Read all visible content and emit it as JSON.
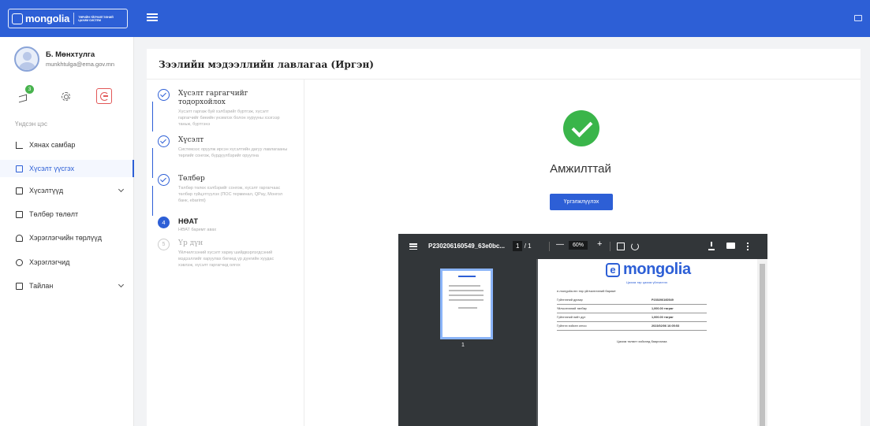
{
  "header": {
    "brand": "mongolia",
    "brand_subtitle": "ТӨРИЙН ҮЙЛЧИЛГЭЭНИЙ ЦАХИМ СИСТЕМ",
    "brand_color": "#2d5fd6"
  },
  "user": {
    "name": "Б. Мөнхтулга",
    "email": "munkhtulga@ema.gov.mn",
    "notification_count": "3"
  },
  "sidebar": {
    "section_label": "Үндсэн цэс",
    "items": [
      {
        "label": "Хянах самбар",
        "icon": "chart-icon"
      },
      {
        "label": "Хүсэлт үүсгэх",
        "icon": "document-icon",
        "active": true
      },
      {
        "label": "Хүсэлтүүд",
        "icon": "requests-icon",
        "expandable": true
      },
      {
        "label": "Төлбөр төлөлт",
        "icon": "card-icon"
      },
      {
        "label": "Хэрэглэгчийн төрлүүд",
        "icon": "user-icon"
      },
      {
        "label": "Хэрэглэгчид",
        "icon": "users-icon"
      },
      {
        "label": "Тайлан",
        "icon": "report-icon",
        "expandable": true
      }
    ]
  },
  "main": {
    "title": "Зээлийн мэдээллийн лавлагаа (Иргэн)",
    "steps": [
      {
        "title": "Хүсэлт гаргагчийг тодорхойлох",
        "description": "Хүсэлт гаргаж буй хэлбэрийг бүртгэж, хүсэлт гаргагчийг биеийн үнэмлэх болон хурууны хээгээр таньж, бүртгэнэ",
        "status": "done"
      },
      {
        "title": "Хүсэлт",
        "description": "Системээс оруулж ирсэн хүсэлтийн дагуу лавлагааны төрлийг сонгож, бүрдүүлбэрийг оруулна",
        "status": "done"
      },
      {
        "title": "Төлбөр",
        "description": "Төлбөр төлөх хэлбэрийг сонгож, хүсэлт гаргагчаас төлбөр гүйцэтгүүлэх (ПОС терминал, QPay, Монгол банк, ebarimt)",
        "status": "done"
      },
      {
        "title": "НӨАТ",
        "number": "4",
        "description": "НӨАТ баримт авах",
        "status": "current"
      },
      {
        "title": "Үр дүн",
        "number": "5",
        "description": "Үйлчилгээний хүсэлт хариу шийдвэрлэгдсэний мэдээллийг харуулах бөгөөд үр дүнгийн хуудас хэвлэж, хүсэлт гаргагчид олгох",
        "status": "pending"
      }
    ],
    "success_text": "Амжилттай",
    "continue_button": "Үргэлжлүүлэх"
  },
  "pdf": {
    "filename": "P230206160549_63e0bc...",
    "page_current": "1",
    "page_total": "1",
    "zoom": "60%",
    "thumb_page_label": "1",
    "doc_brand": "mongolia",
    "doc_brand_sub": "Цахим төр цахим үйлчилгээ",
    "doc_intro": "e-mongolia.mn төр үйлчилгээний баримт",
    "doc_rows": [
      {
        "key": "Гүйлгээний дугаар",
        "value": "P230206160549"
      },
      {
        "key": "Үйлчилгээний төлбөр",
        "value": "1,000.00 төгрөг"
      },
      {
        "key": "Гүйлгээний нийт дүн",
        "value": "1,000.00 төгрөг"
      },
      {
        "key": "Гүйлгээ хийсэн огноо",
        "value": "2023/02/06 16:05:53"
      }
    ],
    "doc_thanks": "Цахим төлөлт хийсэнд баярлалаа"
  },
  "colors": {
    "primary": "#2d5fd6",
    "success": "#3ab54a",
    "logout": "#e25858"
  }
}
